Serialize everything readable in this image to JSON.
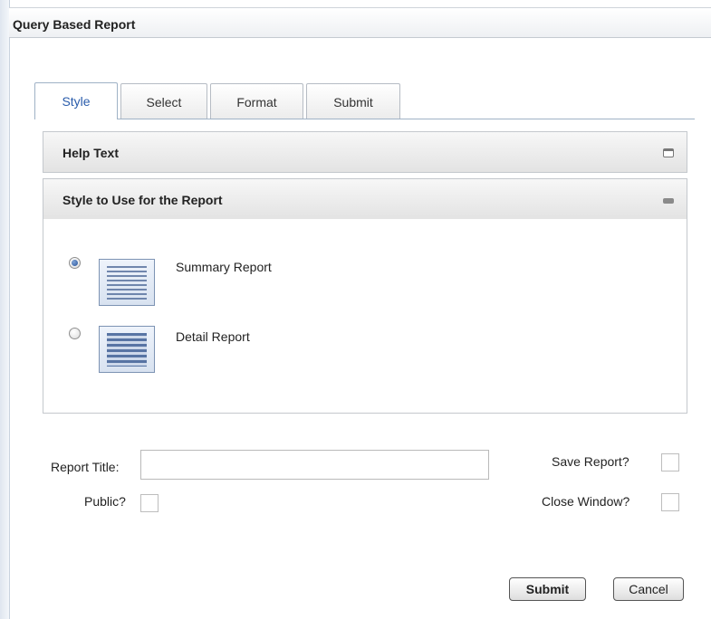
{
  "window": {
    "title": "Query Based Report"
  },
  "tabs": [
    {
      "label": "Style",
      "active": true
    },
    {
      "label": "Select",
      "active": false
    },
    {
      "label": "Format",
      "active": false
    },
    {
      "label": "Submit",
      "active": false
    }
  ],
  "panels": {
    "help": {
      "title": "Help Text",
      "state": "collapsed"
    },
    "style": {
      "title": "Style to Use for the Report",
      "state": "expanded",
      "options": [
        {
          "label": "Summary Report",
          "selected": true,
          "icon": "summary-report-icon"
        },
        {
          "label": "Detail Report",
          "selected": false,
          "icon": "detail-report-icon"
        }
      ]
    }
  },
  "form": {
    "report_title_label": "Report Title:",
    "report_title_value": "",
    "public_label": "Public?",
    "public_checked": false,
    "save_report_label": "Save Report?",
    "save_report_checked": false,
    "close_window_label": "Close Window?",
    "close_window_checked": false
  },
  "buttons": {
    "submit": "Submit",
    "cancel": "Cancel"
  },
  "colors": {
    "active_tab_text": "#2a5cab",
    "tab_underline": "#9fb2c6",
    "radio_selected": "#27539a"
  }
}
